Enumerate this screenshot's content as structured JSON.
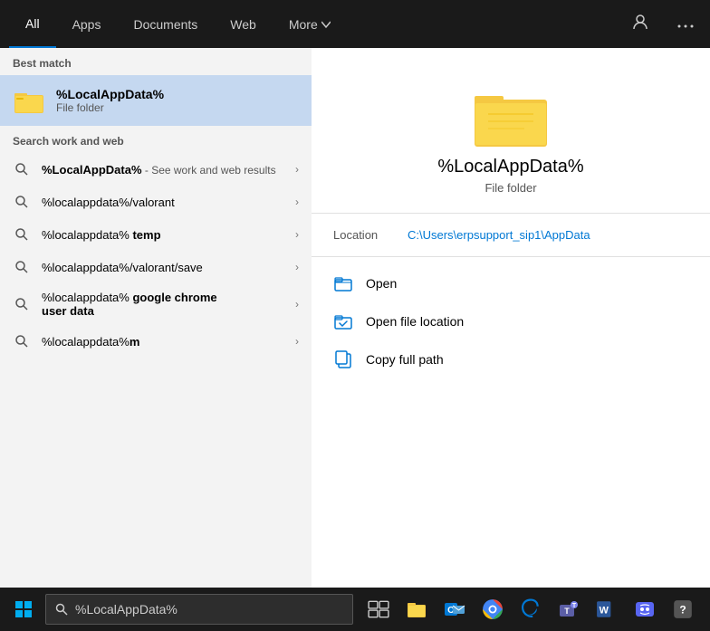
{
  "nav": {
    "tabs": [
      {
        "label": "All",
        "active": true
      },
      {
        "label": "Apps",
        "active": false
      },
      {
        "label": "Documents",
        "active": false
      },
      {
        "label": "Web",
        "active": false
      },
      {
        "label": "More",
        "active": false,
        "hasDropdown": true
      }
    ],
    "icons": {
      "user": "👤",
      "ellipsis": "···"
    }
  },
  "left": {
    "best_match_label": "Best match",
    "best_match": {
      "title": "%LocalAppData%",
      "subtitle": "File folder"
    },
    "search_work_label": "Search work and web",
    "results": [
      {
        "text_main": "%LocalAppData%",
        "text_secondary": " - See work and web results",
        "bold": true,
        "has_chevron": true
      },
      {
        "text_main": "%localappdata%/valorant",
        "bold": false,
        "has_chevron": true
      },
      {
        "text_main_prefix": "%localappdata% ",
        "text_main_bold": "temp",
        "bold": true,
        "has_chevron": true
      },
      {
        "text_main": "%localappdata%/valorant/save",
        "bold": false,
        "has_chevron": true
      },
      {
        "text_main_prefix": "%localappdata% ",
        "text_main_bold": "google chrome user data",
        "bold": true,
        "has_chevron": true,
        "multiline": true
      },
      {
        "text_main_prefix": "%localappdata%",
        "text_main_bold": "m",
        "bold": true,
        "has_chevron": true
      }
    ]
  },
  "right": {
    "title": "%LocalAppData%",
    "subtitle": "File folder",
    "location_label": "Location",
    "location_path": "C:\\Users\\erpsupport_sip1\\AppData",
    "actions": [
      {
        "label": "Open",
        "icon": "folder-open"
      },
      {
        "label": "Open file location",
        "icon": "folder-location"
      },
      {
        "label": "Copy full path",
        "icon": "copy"
      }
    ]
  },
  "taskbar": {
    "search_value": "%LocalAppData%",
    "search_placeholder": "%LocalAppData%"
  }
}
